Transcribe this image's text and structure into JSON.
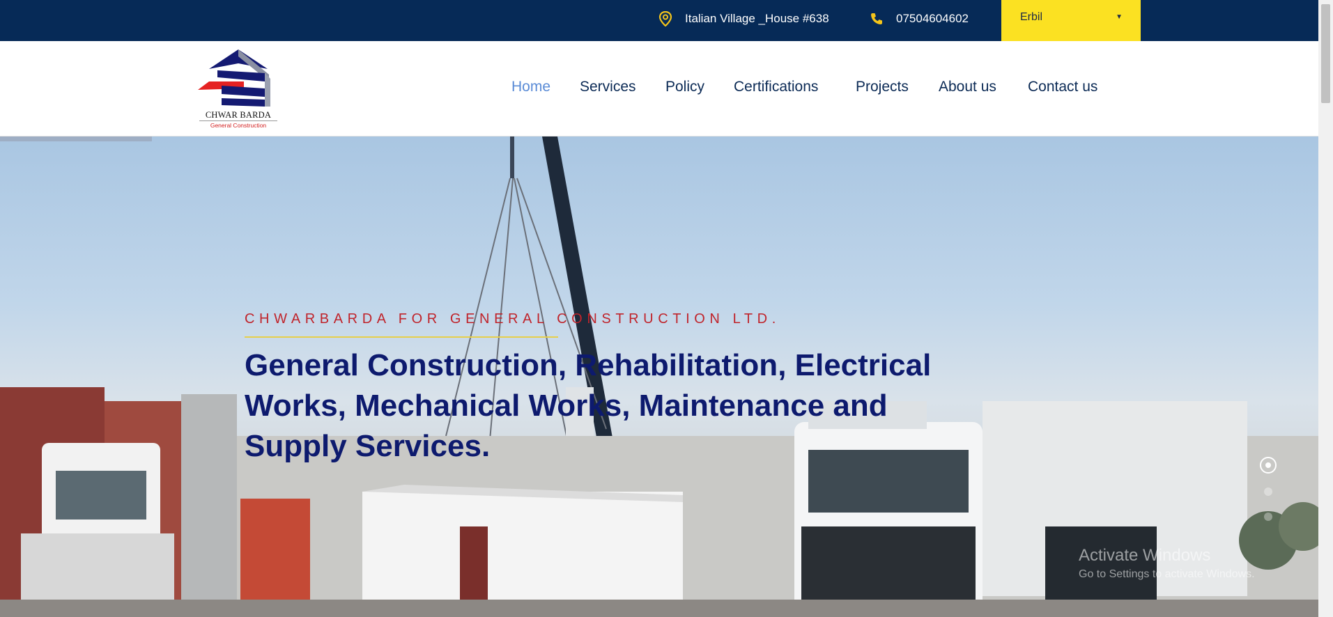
{
  "topbar": {
    "address": "Italian Village _House #638",
    "phone": "07504604602",
    "city_select": {
      "value": "Erbil"
    }
  },
  "brand": {
    "name": "CHWAR BARDA",
    "tagline": "General Construction"
  },
  "nav": {
    "items": [
      {
        "label": "Home",
        "active": true
      },
      {
        "label": "Services",
        "active": false
      },
      {
        "label": "Policy",
        "active": false
      },
      {
        "label": "Certifications",
        "active": false
      },
      {
        "label": "Projects",
        "active": false
      },
      {
        "label": "About us",
        "active": false
      },
      {
        "label": "Contact us",
        "active": false
      }
    ]
  },
  "hero": {
    "subtitle": "CHWARBARDA FOR GENERAL CONSTRUCTION LTD.",
    "title": "General Construction, Rehabilitation, Electrical Works, Mechanical Works, Maintenance and Supply Services.",
    "slide_count": 3,
    "active_slide": 1
  },
  "os_watermark": {
    "line1": "Activate Windows",
    "line2": "Go to Settings to activate Windows."
  },
  "colors": {
    "topbar_bg": "#062a57",
    "accent_yellow": "#fbe122",
    "nav_text": "#0b2a55",
    "nav_active": "#5a8bd6",
    "hero_subtitle": "#c0242b",
    "hero_title": "#0d1a6e"
  },
  "icons": [
    "map-pin-icon",
    "phone-icon",
    "dropdown-arrow-icon"
  ]
}
